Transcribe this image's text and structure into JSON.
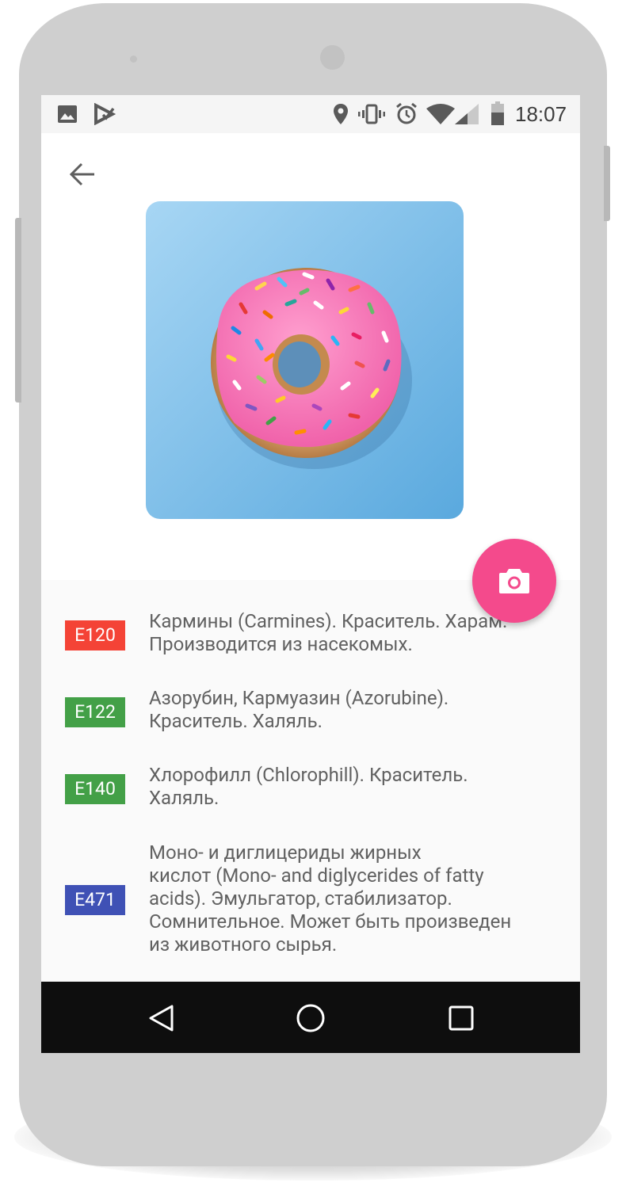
{
  "status_bar": {
    "time": "18:07",
    "left_icons": [
      "image-icon",
      "nfc-icon"
    ],
    "right_icons": [
      "location-icon",
      "vibrate-icon",
      "alarm-icon",
      "wifi-icon",
      "signal-icon",
      "battery-icon"
    ]
  },
  "toolbar": {
    "back_icon": "arrow-back-icon"
  },
  "photo": {
    "subject": "donut-image",
    "background_color": "#7fc3ec"
  },
  "fab": {
    "icon": "camera-icon",
    "color": "#f44a8c"
  },
  "additives": [
    {
      "code": "E120",
      "color": "#f44336",
      "lines": [
        "Кармины (Carmines). Краситель. Харам.",
        "Производится из насекомых."
      ]
    },
    {
      "code": "E122",
      "color": "#43a047",
      "lines": [
        "Азорубин, Кармуазин (Azorubine).",
        "Краситель. Халяль."
      ]
    },
    {
      "code": "E140",
      "color": "#43a047",
      "lines": [
        "Хлорофилл (Chlorophill). Краситель.",
        "Халяль."
      ]
    },
    {
      "code": "E471",
      "color": "#3f51b5",
      "lines": [
        "Моно- и диглицериды жирных",
        "кислот (Mono- and diglycerides of fatty",
        "acids). Эмульгатор, стабилизатор.",
        "Сомнительное. Может быть произведен",
        "из животного сырья."
      ]
    }
  ],
  "nav_bar": {
    "back": "nav-back-icon",
    "home": "nav-home-icon",
    "recents": "nav-recents-icon"
  }
}
